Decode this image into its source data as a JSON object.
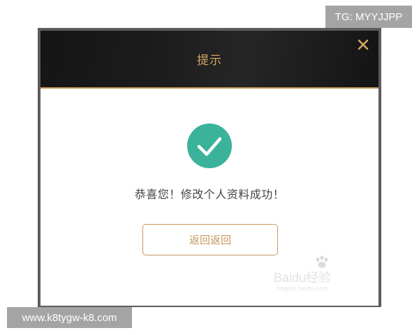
{
  "overlay": {
    "tg_badge": "TG: MYYJJPP",
    "site_banner": "www.k8tygw-k8.com"
  },
  "dialog": {
    "title": "提示",
    "close_icon": "close-icon",
    "success_icon": "checkmark-circle-icon",
    "message": "恭喜您！修改个人资料成功！",
    "return_button_label": "返回返回"
  },
  "watermark": {
    "brand_text": "Baidu经验",
    "sub_text": "jingyan.baidu.com"
  },
  "colors": {
    "header_bg": "#1a1a1a",
    "accent_gold": "#c89b5e",
    "success_green": "#3bb39a",
    "frame_gray": "#5c5c5c"
  }
}
